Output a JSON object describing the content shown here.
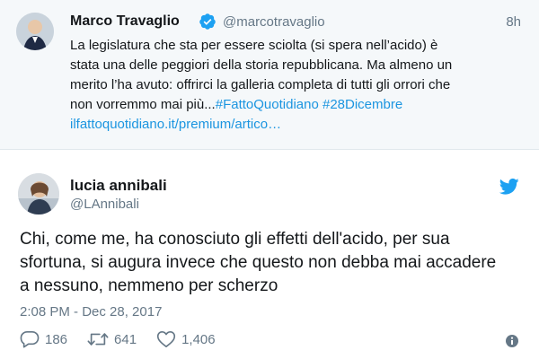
{
  "quoted": {
    "name": "Marco Travaglio",
    "handle": "@marcotravaglio",
    "time": "8h",
    "text_lines": [
      "La legislatura che sta per essere sciolta (si spera nell’acido) è",
      "stata una delle peggiori della storia repubblicana. Ma almeno un",
      "merito l’ha avuto: offrirci la galleria completa di tutti gli orrori che"
    ],
    "text_last": "non vorremmo mai più...",
    "hashtag1": "#FattoQuotidiano",
    "hashtag2": "#28Dicembre",
    "link": "ilfattoquotidiano.it/premium/artico…"
  },
  "tweet": {
    "name": "lucia annibali",
    "handle": "@LAnnibali",
    "text_lines": [
      "Chi, come me, ha conosciuto gli effetti dell'acido, per sua",
      "sfortuna, si augura invece che questo non debba mai accadere",
      "a nessuno, nemmeno per scherzo"
    ],
    "timestamp": "2:08 PM - Dec 28, 2017"
  },
  "actions": {
    "replies": "186",
    "retweets": "641",
    "likes": "1,406"
  },
  "icons": {
    "verified": "verified-badge-icon",
    "bird": "twitter-bird-icon",
    "reply": "reply-icon",
    "retweet": "retweet-icon",
    "like": "heart-icon",
    "info": "info-icon"
  },
  "colors": {
    "brand": "#1da1f2",
    "link": "#1b95e0",
    "muted": "#657786",
    "quoted_bg": "#f5f8fa"
  }
}
